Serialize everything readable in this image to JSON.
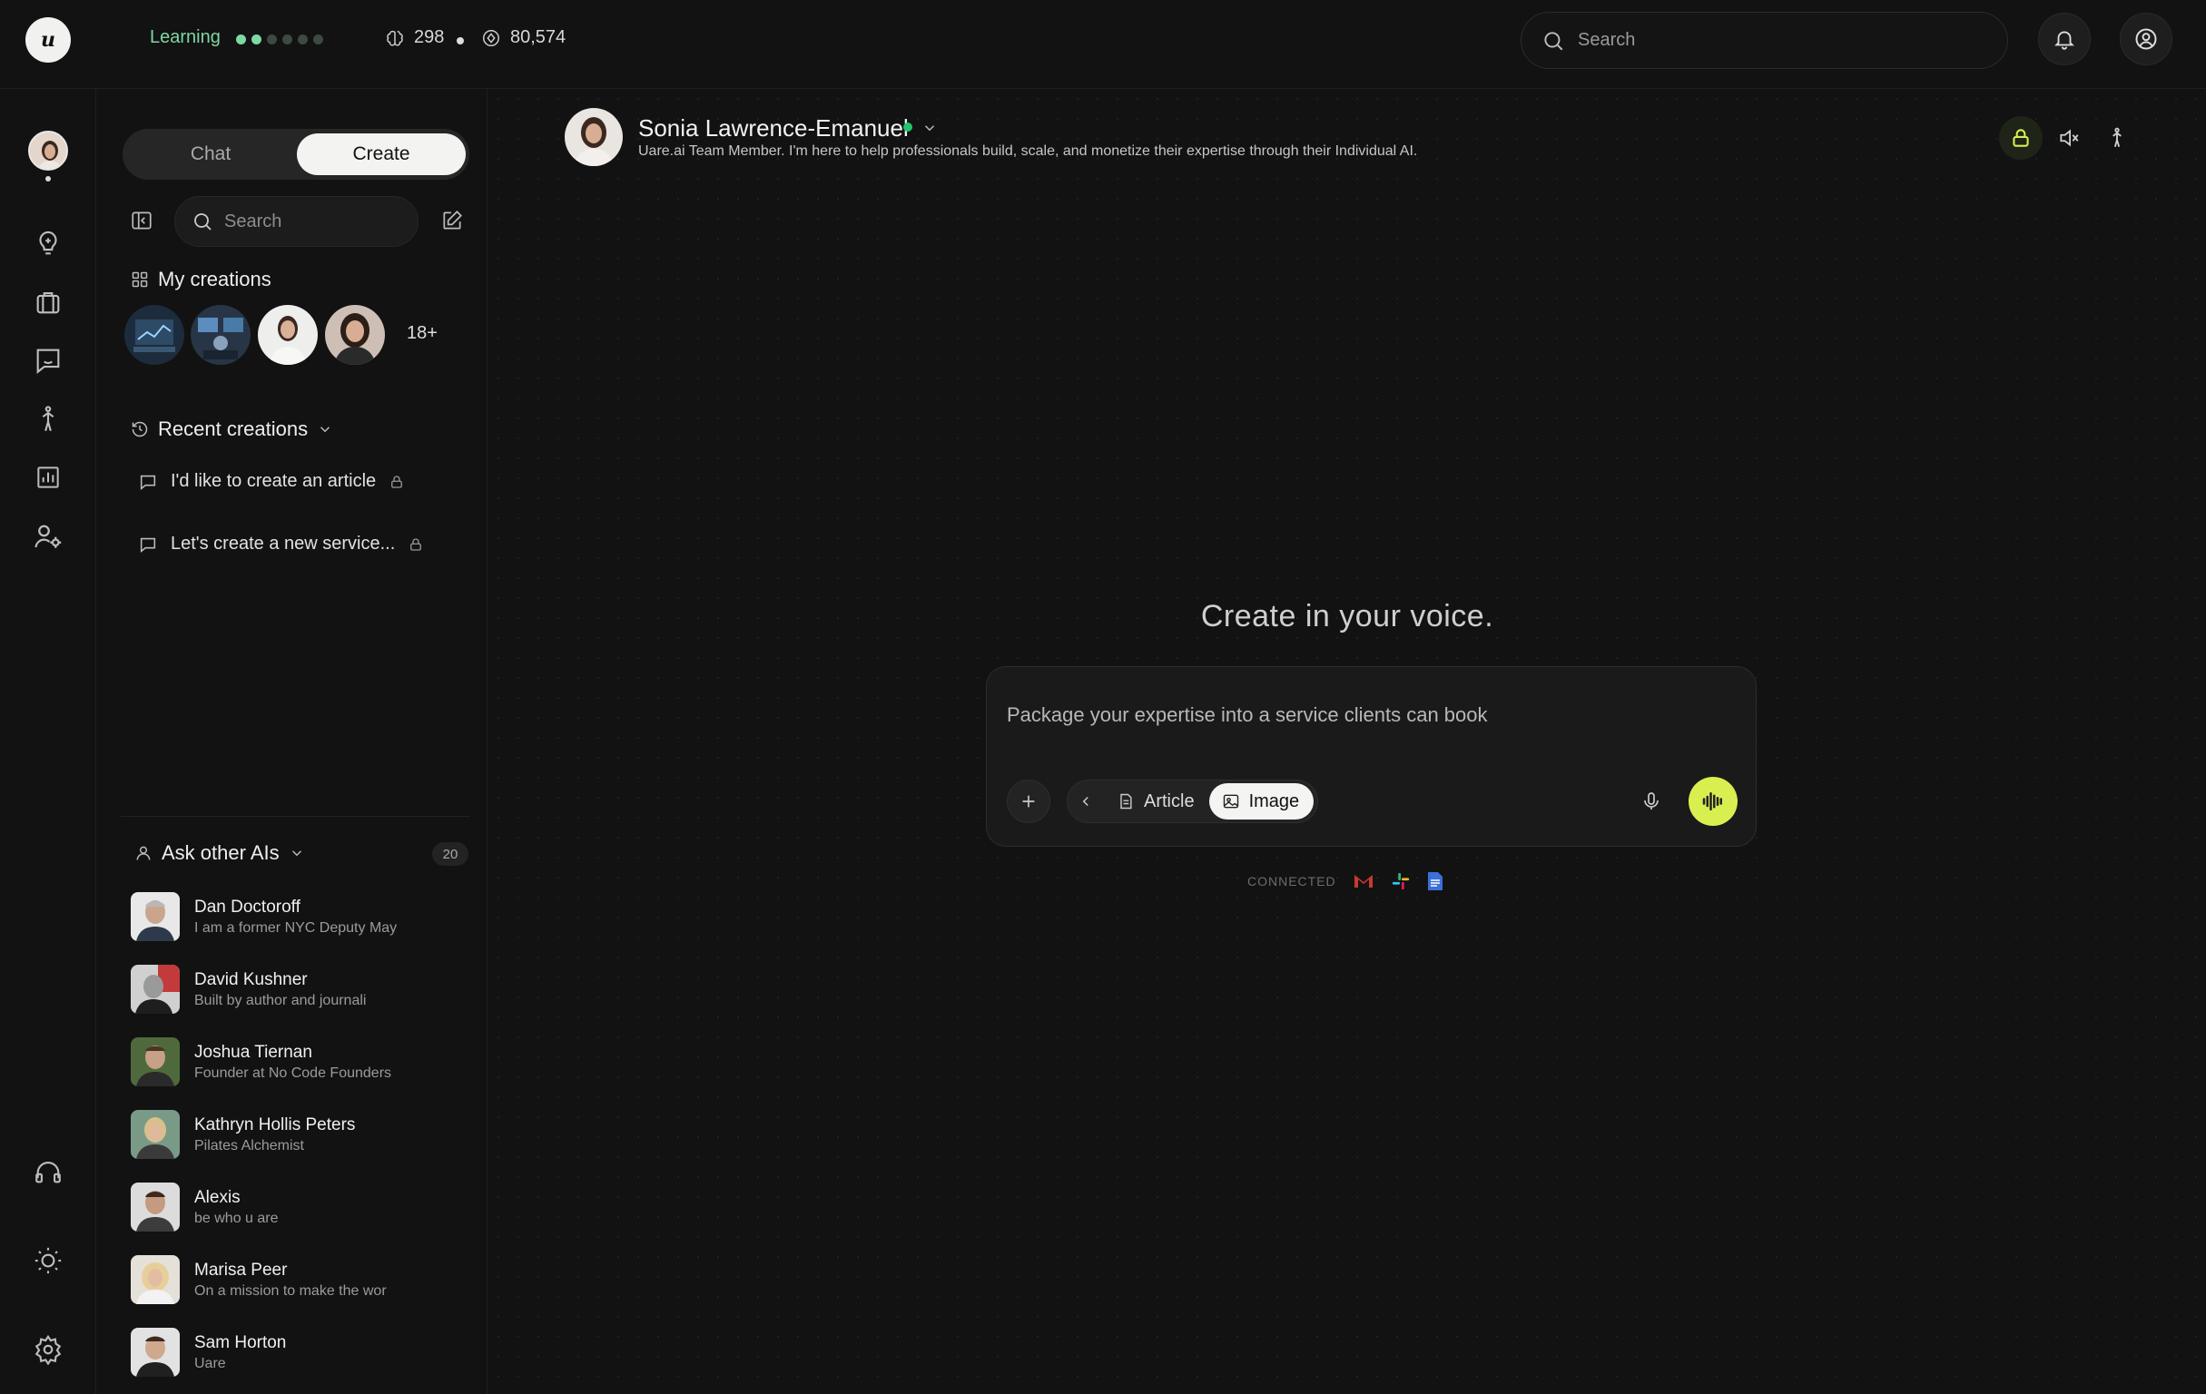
{
  "topbar": {
    "learning_label": "Learning",
    "progress_dots_filled": 2,
    "progress_dots_total": 6,
    "stat_tokens": "298",
    "stat_points": "80,574",
    "search_placeholder": "Search"
  },
  "rail": {
    "items": [
      "profile-avatar",
      "lightbulb-icon",
      "briefcase-icon",
      "chat-smile-icon",
      "person-walking-icon",
      "chart-icon",
      "user-settings-icon",
      "headphones-icon",
      "sun-icon",
      "gear-icon"
    ]
  },
  "sidebar": {
    "tabs": [
      {
        "label": "Chat",
        "active": false
      },
      {
        "label": "Create",
        "active": true
      }
    ],
    "search_placeholder": "Search",
    "my_creations": {
      "title": "My creations",
      "more_label": "18+"
    },
    "recent_creations": {
      "title": "Recent creations",
      "items": [
        {
          "label": "I'd like to create an article"
        },
        {
          "label": "Let's create a new service..."
        }
      ]
    },
    "ask_other_ais": {
      "title": "Ask other AIs",
      "count": "20",
      "items": [
        {
          "name": "Dan Doctoroff",
          "desc": "I am a former NYC Deputy May"
        },
        {
          "name": "David Kushner",
          "desc": "Built by author and journali"
        },
        {
          "name": "Joshua Tiernan",
          "desc": "Founder at No Code Founders"
        },
        {
          "name": "Kathryn Hollis Peters",
          "desc": "Pilates Alchemist"
        },
        {
          "name": "Alexis",
          "desc": "be who u are"
        },
        {
          "name": "Marisa Peer",
          "desc": "On a mission to make the wor"
        },
        {
          "name": "Sam Horton",
          "desc": "Uare"
        }
      ]
    }
  },
  "main": {
    "profile": {
      "name": "Sonia Lawrence-Emanuel",
      "status": "online",
      "description": "Uare.ai Team Member. I'm here to help professionals build, scale, and monetize their expertise through their Individual AI."
    },
    "headline": "Create in your voice.",
    "composer": {
      "placeholder": "Package your expertise into a service clients can book",
      "chips": [
        {
          "label": "Article",
          "active": false
        },
        {
          "label": "Image",
          "active": true
        }
      ]
    },
    "connected": {
      "label": "CONNECTED",
      "services": [
        "gmail-icon",
        "slack-icon",
        "google-docs-icon"
      ]
    }
  },
  "colors": {
    "background": "#121212",
    "accent_green": "#7dd8a2",
    "voice_button": "#d8ef4f",
    "online": "#23c46a"
  }
}
